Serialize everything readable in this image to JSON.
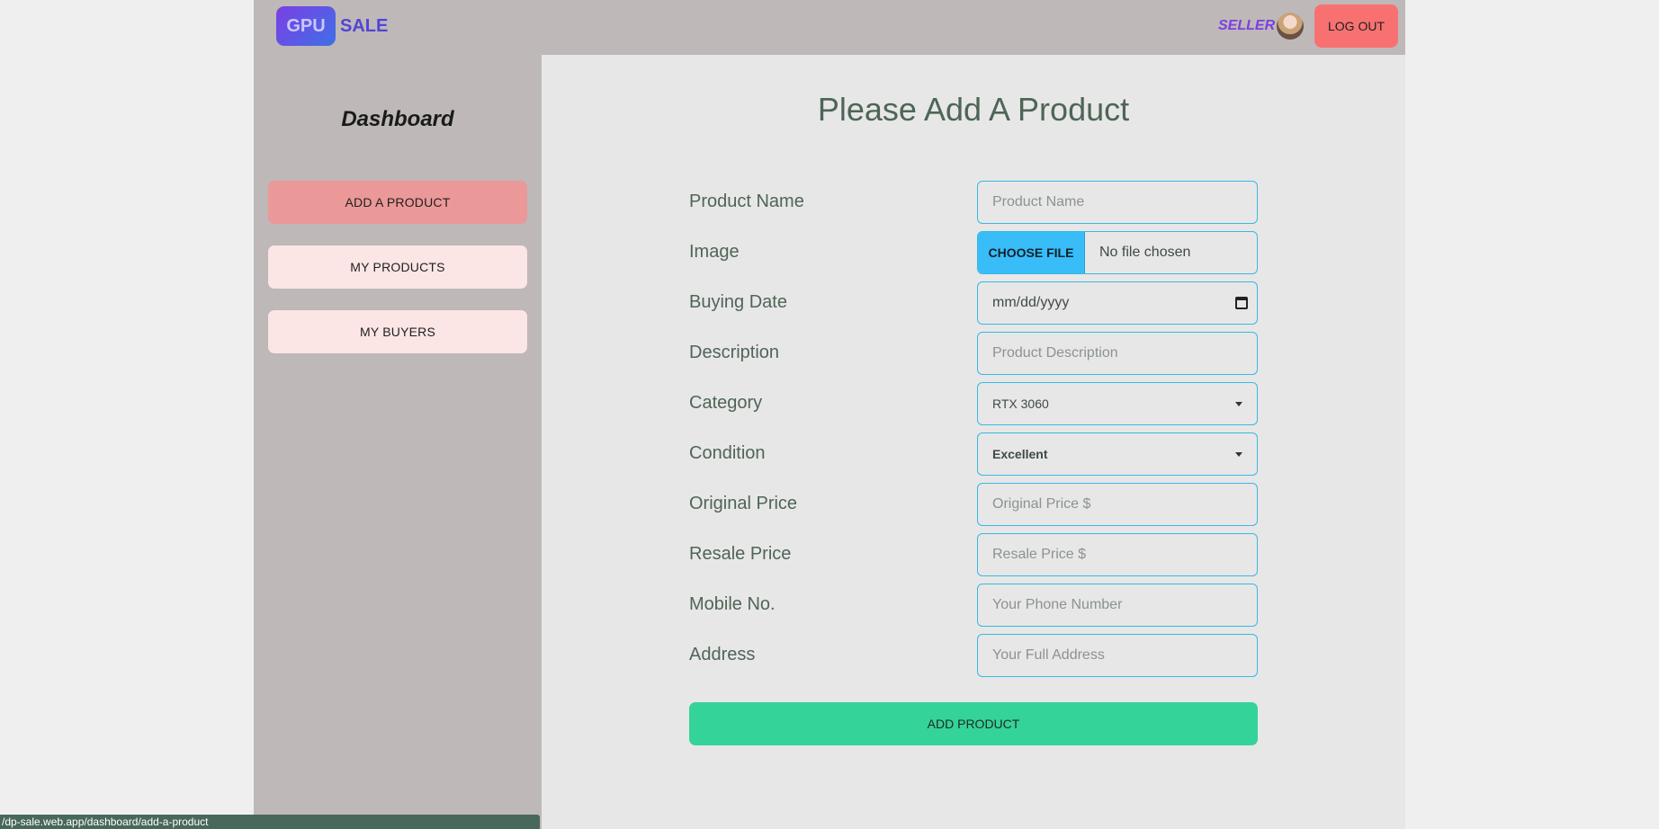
{
  "header": {
    "logo_part1": "GPU",
    "logo_part2": "SALE",
    "role": "SELLER",
    "logout_label": "LOG OUT"
  },
  "sidebar": {
    "title": "Dashboard",
    "items": [
      {
        "label": "ADD A PRODUCT",
        "active": true
      },
      {
        "label": "MY PRODUCTS",
        "active": false
      },
      {
        "label": "MY BUYERS",
        "active": false
      }
    ]
  },
  "form": {
    "heading": "Please Add A Product",
    "fields": {
      "product_name": {
        "label": "Product Name",
        "placeholder": "Product Name"
      },
      "image": {
        "label": "Image",
        "button": "CHOOSE FILE",
        "status": "No file chosen"
      },
      "buying_date": {
        "label": "Buying Date",
        "value": "mm/dd/yyyy"
      },
      "description": {
        "label": "Description",
        "placeholder": "Product Description"
      },
      "category": {
        "label": "Category",
        "value": "RTX 3060"
      },
      "condition": {
        "label": "Condition",
        "value": "Excellent"
      },
      "original_price": {
        "label": "Original Price",
        "placeholder": "Original Price $"
      },
      "resale_price": {
        "label": "Resale Price",
        "placeholder": "Resale Price $"
      },
      "mobile": {
        "label": "Mobile No.",
        "placeholder": "Your Phone Number"
      },
      "address": {
        "label": "Address",
        "placeholder": "Your Full Address"
      }
    },
    "submit_label": "ADD PRODUCT"
  },
  "status_bar": {
    "url": "/dp-sale.web.app/dashboard/add-a-product"
  },
  "colors": {
    "brand": "#5145d6",
    "accent_active": "#eb9898",
    "logout": "#f87171",
    "submit": "#34d399",
    "input_border": "#38b8e4"
  }
}
